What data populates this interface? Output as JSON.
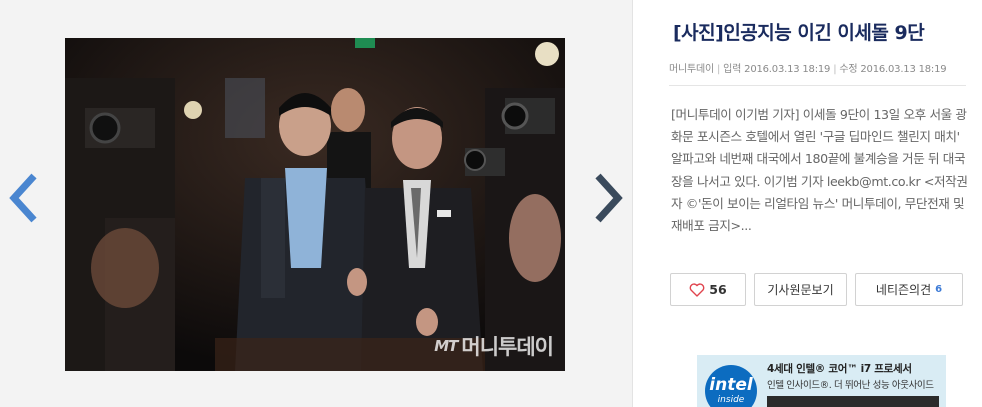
{
  "viewer": {
    "prev_label": "이전 사진",
    "next_label": "다음 사진",
    "photo_alt": "[사진]인공지능 이긴 이세돌 9단",
    "watermark_brand": "MT",
    "watermark_name": "머니투데이"
  },
  "article": {
    "title": "[사진]인공지능 이긴 이세돌 9단",
    "source": "머니투데이",
    "input_label": "입력",
    "input_time": "2016.03.13 18:19",
    "edit_label": "수정",
    "edit_time": "2016.03.13 18:19",
    "summary": "[머니투데이 이기범 기자] 이세돌 9단이 13일 오후 서울 광화문 포시즌스 호텔에서 열린 '구글 딥마인드 챌린지 매치' 알파고와 네번째 대국에서 180끝에 불계승을 거둔 뒤 대국장을 나서고 있다. 이기범 기자 leekb@mt.co.kr <저작권자 ©'돈이 보이는 리얼타임 뉴스' 머니투데이, 무단전재 및 재배포 금지>..."
  },
  "actions": {
    "like_count": "56",
    "original_label": "기사원문보기",
    "comments_label": "네티즌의견",
    "comments_count": "6"
  },
  "ad": {
    "logo_text": "intel",
    "logo_sub": "inside",
    "line1": "4세대 인텔® 코어™ i7 프로세서",
    "line2": "인텔 인사이드®. 더 뛰어난 성능 아웃사이드"
  },
  "colors": {
    "title": "#1a2b5e",
    "arrow_prev": "#4a86d0",
    "arrow_next": "#3a4a5c",
    "heart": "#e0444e",
    "comment_count": "#3d7bd6"
  },
  "icons": {
    "prev": "chevron-left-icon",
    "next": "chevron-right-icon",
    "like": "heart-icon"
  }
}
